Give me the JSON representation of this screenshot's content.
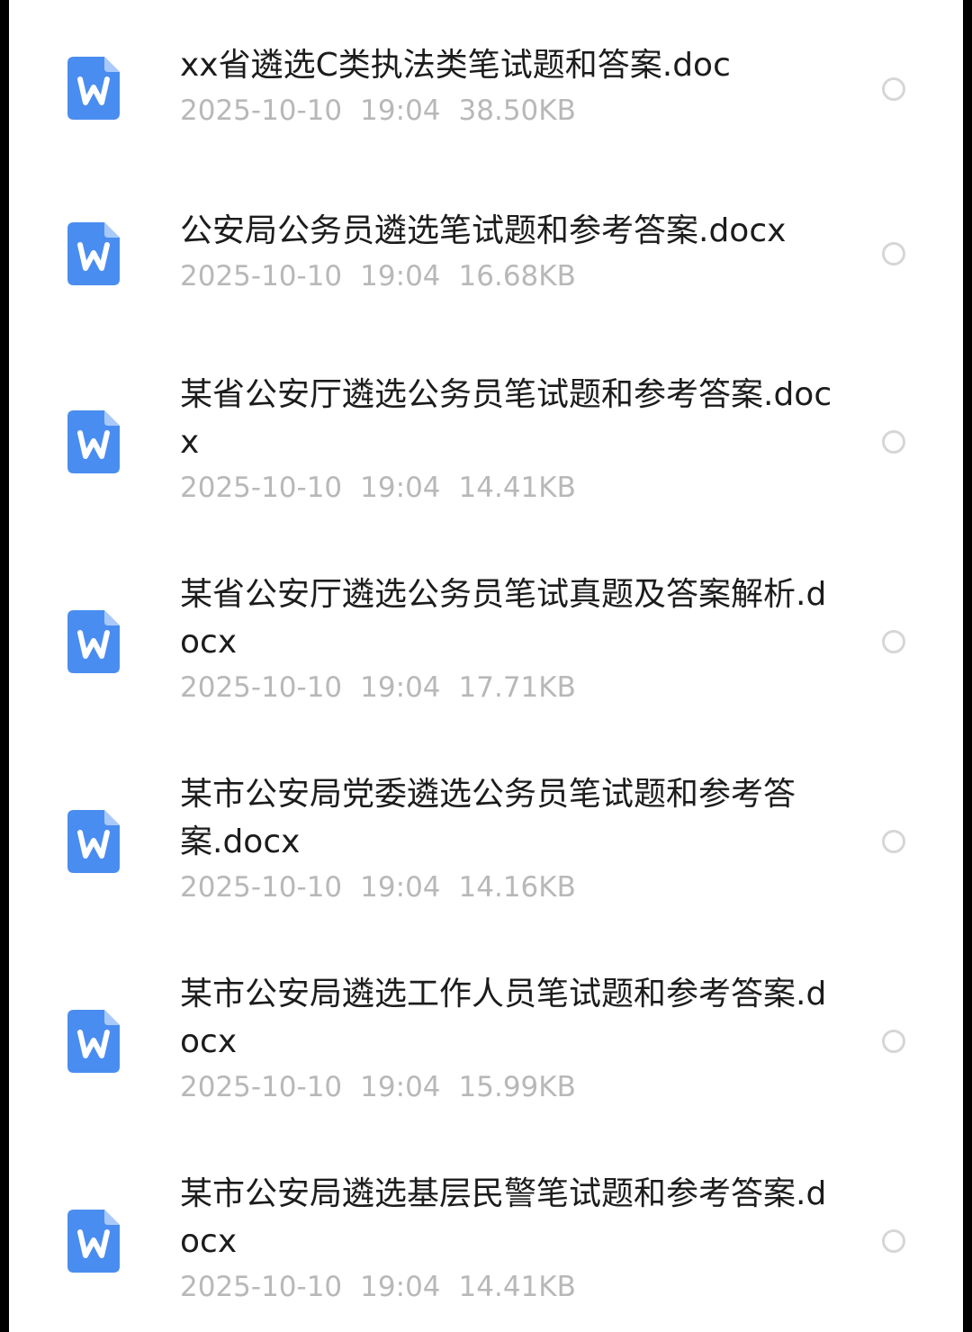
{
  "files": [
    {
      "name": "xx省遴选C类执法类笔试题和答案.doc",
      "date": "2025-10-10",
      "time": "19:04",
      "size": "38.50KB",
      "icon": "word-doc-icon",
      "selected": false
    },
    {
      "name": "公安局公务员遴选笔试题和参考答案.docx",
      "date": "2025-10-10",
      "time": "19:04",
      "size": "16.68KB",
      "icon": "word-doc-icon",
      "selected": false
    },
    {
      "name": "某省公安厅遴选公务员笔试题和参考答案.docx",
      "date": "2025-10-10",
      "time": "19:04",
      "size": "14.41KB",
      "icon": "word-doc-icon",
      "selected": false
    },
    {
      "name": "某省公安厅遴选公务员笔试真题及答案解析.docx",
      "date": "2025-10-10",
      "time": "19:04",
      "size": "17.71KB",
      "icon": "word-doc-icon",
      "selected": false
    },
    {
      "name": "某市公安局党委遴选公务员笔试题和参考答案.docx",
      "date": "2025-10-10",
      "time": "19:04",
      "size": "14.16KB",
      "icon": "word-doc-icon",
      "selected": false
    },
    {
      "name": "某市公安局遴选工作人员笔试题和参考答案.docx",
      "date": "2025-10-10",
      "time": "19:04",
      "size": "15.99KB",
      "icon": "word-doc-icon",
      "selected": false
    },
    {
      "name": "某市公安局遴选基层民警笔试题和参考答案.docx",
      "date": "2025-10-10",
      "time": "19:04",
      "size": "14.41KB",
      "icon": "word-doc-icon",
      "selected": false
    }
  ],
  "colors": {
    "icon": "#4a8df0",
    "icon_fold": "#a9c9fb",
    "name_text": "#1c1c1c",
    "meta_text": "#b8b8b8",
    "radio_border": "#d6d6d6",
    "background": "#ffffff",
    "frame": "#000000"
  }
}
